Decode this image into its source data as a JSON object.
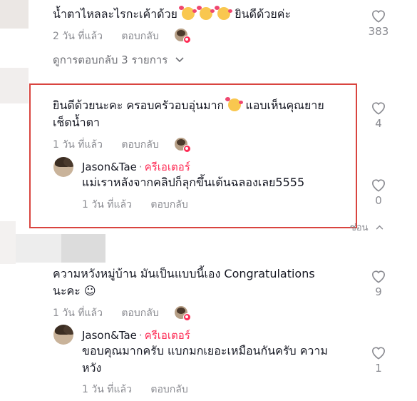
{
  "comments": [
    {
      "text_before_emoji": "น้ำตาไหลละไรกะเค้าด้วย",
      "text_after_emoji": "ยินดีด้วยค่ะ",
      "time": "2 วัน ที่แล้ว",
      "reply": "ตอบกลับ",
      "likes": "383",
      "view_replies": "ดูการตอบกลับ 3 รายการ"
    },
    {
      "line1_before_emoji": "ยินดีด้วยนะคะ ครอบครัวอบอุ่นมาก",
      "line1_after_emoji": "แอบเห็นคุณยาย",
      "line2": "เช็ดน้ำตา",
      "time": "1 วัน ที่แล้ว",
      "reply": "ตอบกลับ",
      "likes": "4",
      "creator_reply": {
        "author": "Jason&Tae",
        "creator_label": "ครีเอเตอร์",
        "text": "แม่เราหลังจากคลิปก็ลุกขึ้นเต้นฉลองเลย5555",
        "time": "1 วัน ที่แล้ว",
        "reply": "ตอบกลับ",
        "likes": "0"
      },
      "collapse_label": "ซ่อน"
    },
    {
      "line1": "ความหวังหมู่บ้าน มันเป็นแบบนี้เอง Congratulations",
      "line2": "นะคะ ☺",
      "time": "1 วัน ที่แล้ว",
      "reply": "ตอบกลับ",
      "likes": "9",
      "creator_reply": {
        "author": "Jason&Tae",
        "creator_label": "ครีเอเตอร์",
        "line1": "ขอบคุณมากครับ แบกมกเยอะเหมือนกันครับ ความ",
        "line2": "หวัง",
        "time": "1 วัน ที่แล้ว",
        "reply": "ตอบกลับ",
        "likes": "1"
      }
    }
  ]
}
